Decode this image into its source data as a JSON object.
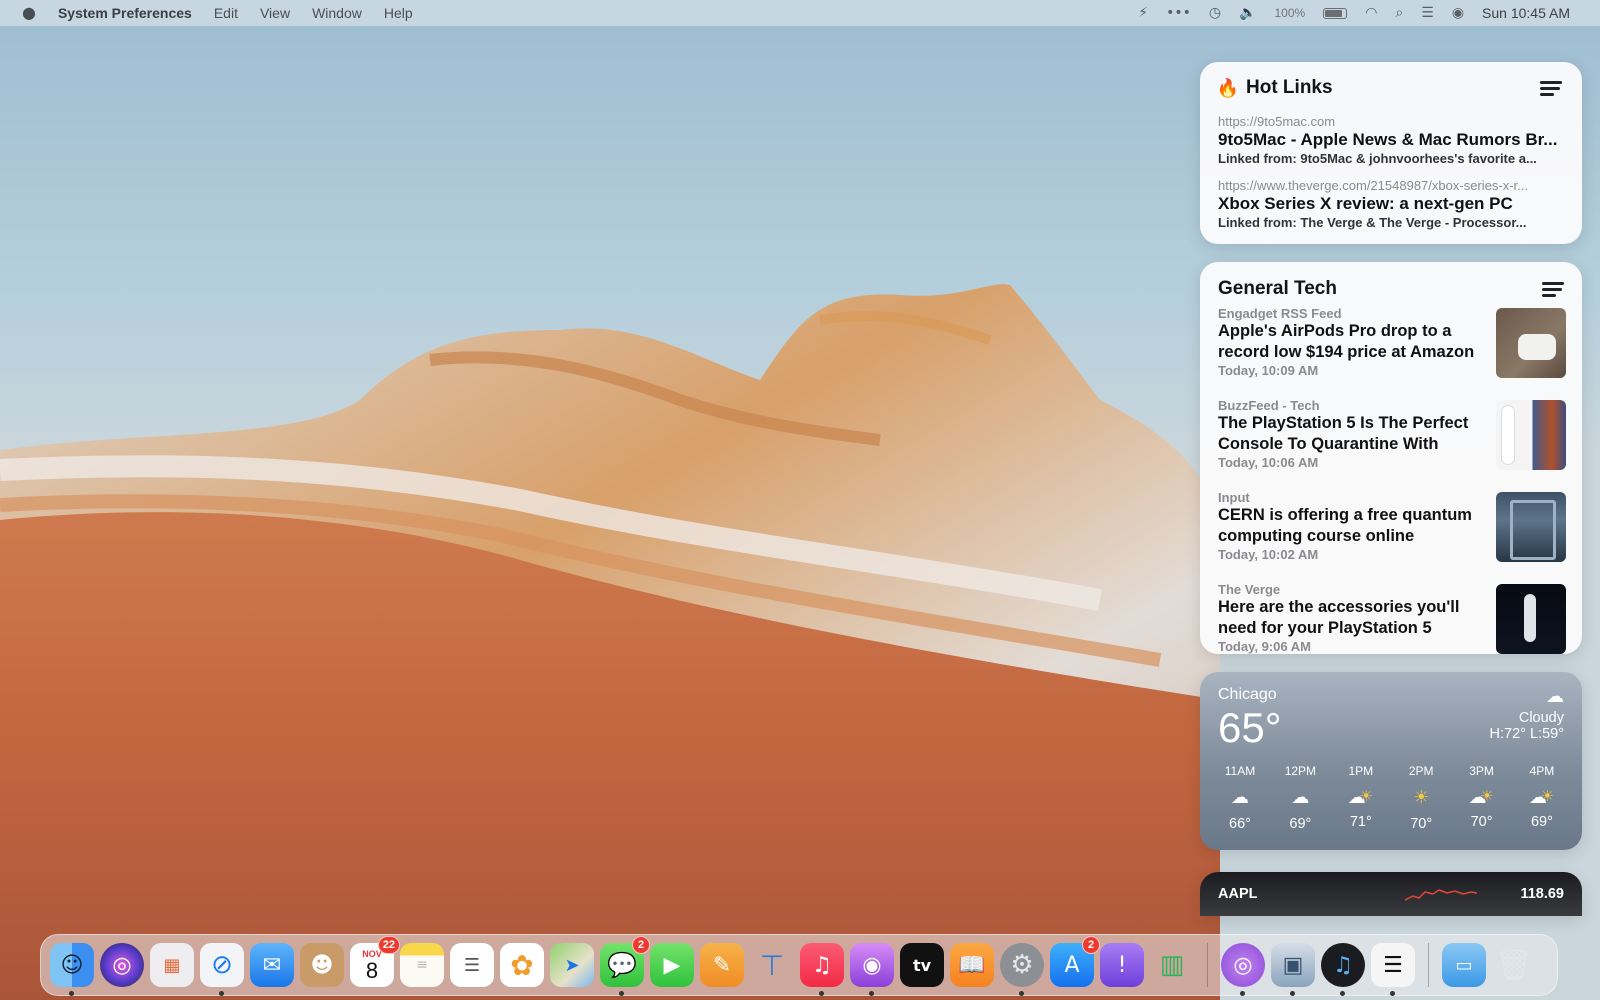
{
  "menubar": {
    "apple_icon": "apple-logo",
    "app_name": "System Preferences",
    "menus": [
      "Edit",
      "View",
      "Window",
      "Help"
    ],
    "battery_percent": "100%",
    "clock": "Sun 10:45 AM",
    "status_icons": [
      "reeder-icon",
      "more-icon",
      "time-machine-icon",
      "volume-icon",
      "battery-icon",
      "wifi-icon",
      "spotlight-icon",
      "control-center-icon",
      "siri-icon"
    ]
  },
  "hot_links": {
    "title": "Hot Links",
    "items": [
      {
        "url": "https://9to5mac.com",
        "title": "9to5Mac - Apple News & Mac Rumors Br...",
        "from_label": "Linked from:",
        "from": "9to5Mac & johnvoorhees's favorite a..."
      },
      {
        "url": "https://www.theverge.com/21548987/xbox-series-x-r...",
        "title": "Xbox Series X review: a next-gen PC",
        "from_label": "Linked from:",
        "from": "The Verge & The Verge -  Processor..."
      }
    ]
  },
  "general_tech": {
    "title": "General Tech",
    "items": [
      {
        "source": "Engadget RSS Feed",
        "title": "Apple's AirPods Pro drop to a record low $194 price at Amazon",
        "time": "Today, 10:09 AM"
      },
      {
        "source": "BuzzFeed - Tech",
        "title": "The PlayStation 5 Is The Perfect Console To Quarantine With",
        "time": "Today, 10:06 AM"
      },
      {
        "source": "Input",
        "title": "CERN is offering a free quantum computing course online",
        "time": "Today, 10:02 AM"
      },
      {
        "source": "The Verge",
        "title": "Here are the accessories you'll need for your PlayStation 5",
        "time": "Today, 9:06 AM"
      }
    ]
  },
  "weather": {
    "city": "Chicago",
    "temp": "65°",
    "condition": "Cloudy",
    "high_low": "H:72° L:59°",
    "hours": [
      {
        "label": "11AM",
        "icon": "cloud",
        "temp": "66°"
      },
      {
        "label": "12PM",
        "icon": "cloud",
        "temp": "69°"
      },
      {
        "label": "1PM",
        "icon": "partly-sunny",
        "temp": "71°"
      },
      {
        "label": "2PM",
        "icon": "sun",
        "temp": "70°"
      },
      {
        "label": "3PM",
        "icon": "partly-sunny",
        "temp": "70°"
      },
      {
        "label": "4PM",
        "icon": "partly-sunny",
        "temp": "69°"
      }
    ]
  },
  "stocks": {
    "symbol": "AAPL",
    "price": "118.69",
    "accent": "#e6453b"
  },
  "dock": {
    "calendar_month": "NOV",
    "calendar_day": "8",
    "calendar_badge": "22",
    "messages_badge": "2",
    "app_store_badge": "2",
    "apps": [
      "Finder",
      "Siri",
      "Launchpad",
      "Safari",
      "Mail",
      "Contacts",
      "Calendar",
      "Notes",
      "Reminders",
      "Photos",
      "Maps",
      "Messages",
      "FaceTime",
      "Pages",
      "Keynote",
      "Music",
      "Podcasts",
      "TV",
      "Books",
      "System Preferences",
      "App Store",
      "Feedback Assistant",
      "Numbers",
      "Podcast Sources",
      "Preview",
      "Music Player",
      "Reeder",
      "Downloads",
      "Trash"
    ]
  }
}
